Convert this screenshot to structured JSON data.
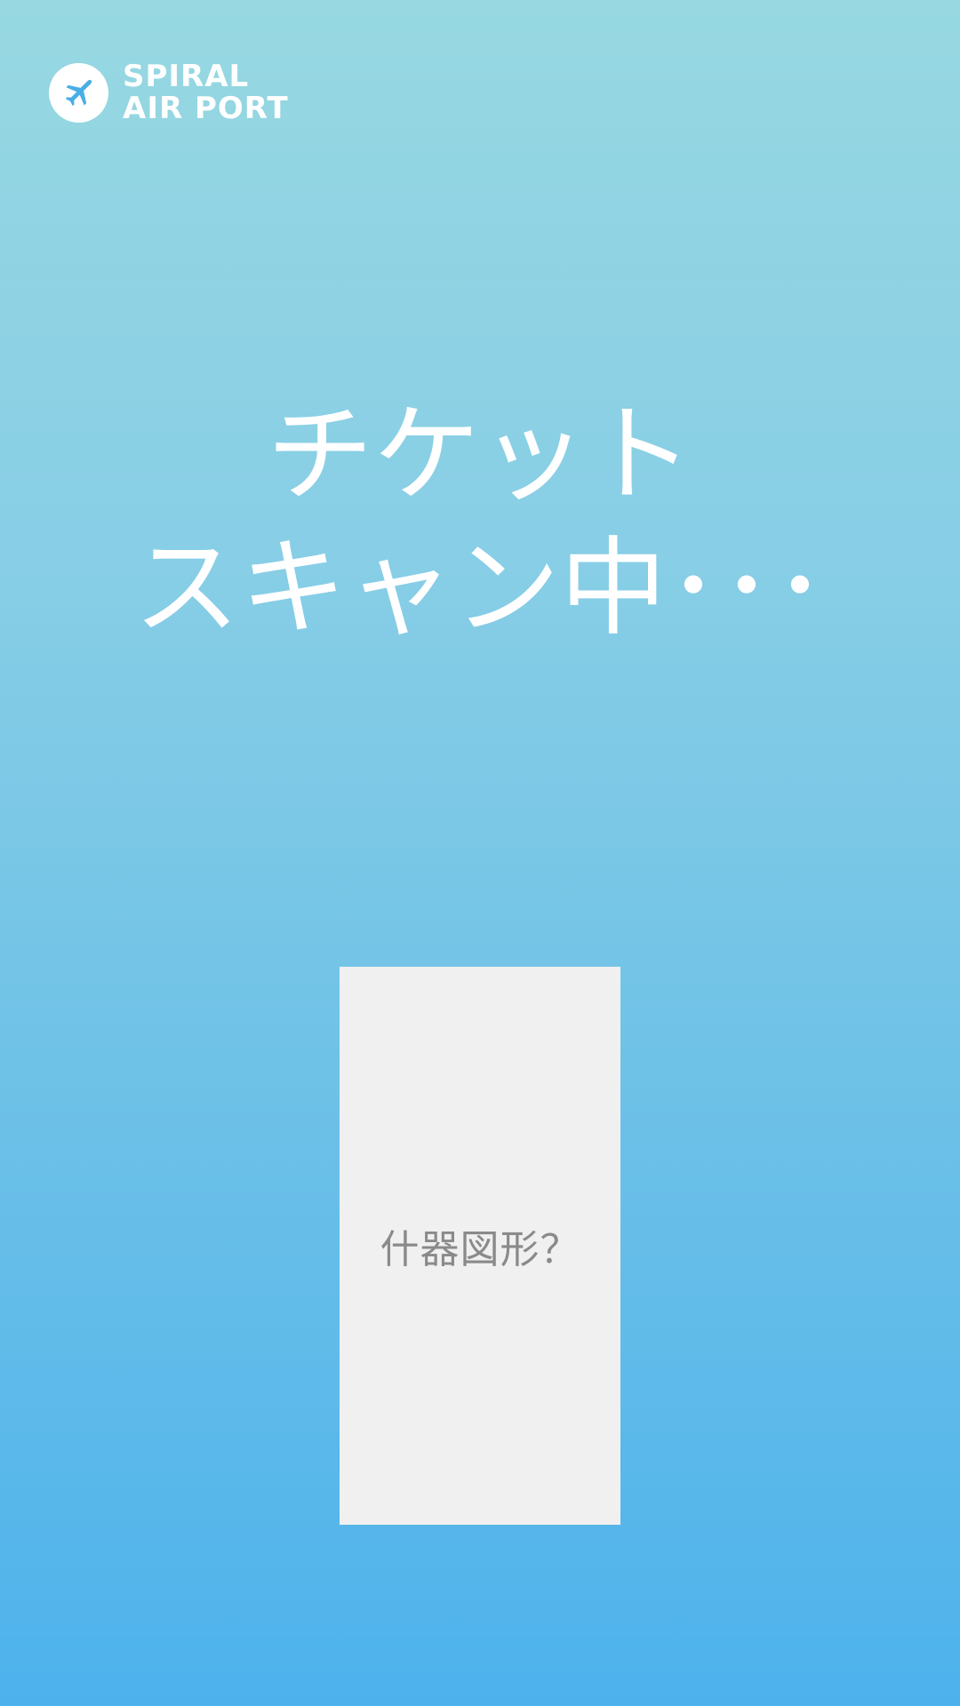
{
  "brand": {
    "line1": "SPIRAL",
    "line2": "AIR PORT",
    "icon": "airplane-icon"
  },
  "status": {
    "line1": "チケット",
    "line2": "スキャン中･･･"
  },
  "placeholder": {
    "label": "什器図形？"
  },
  "colors": {
    "background_top": "#97d8e1",
    "background_bottom": "#4db2ec",
    "text": "#ffffff",
    "placeholder_fill": "#f0f0f0",
    "placeholder_text": "#8a8a8a",
    "logo_plane": "#4aaee6"
  }
}
